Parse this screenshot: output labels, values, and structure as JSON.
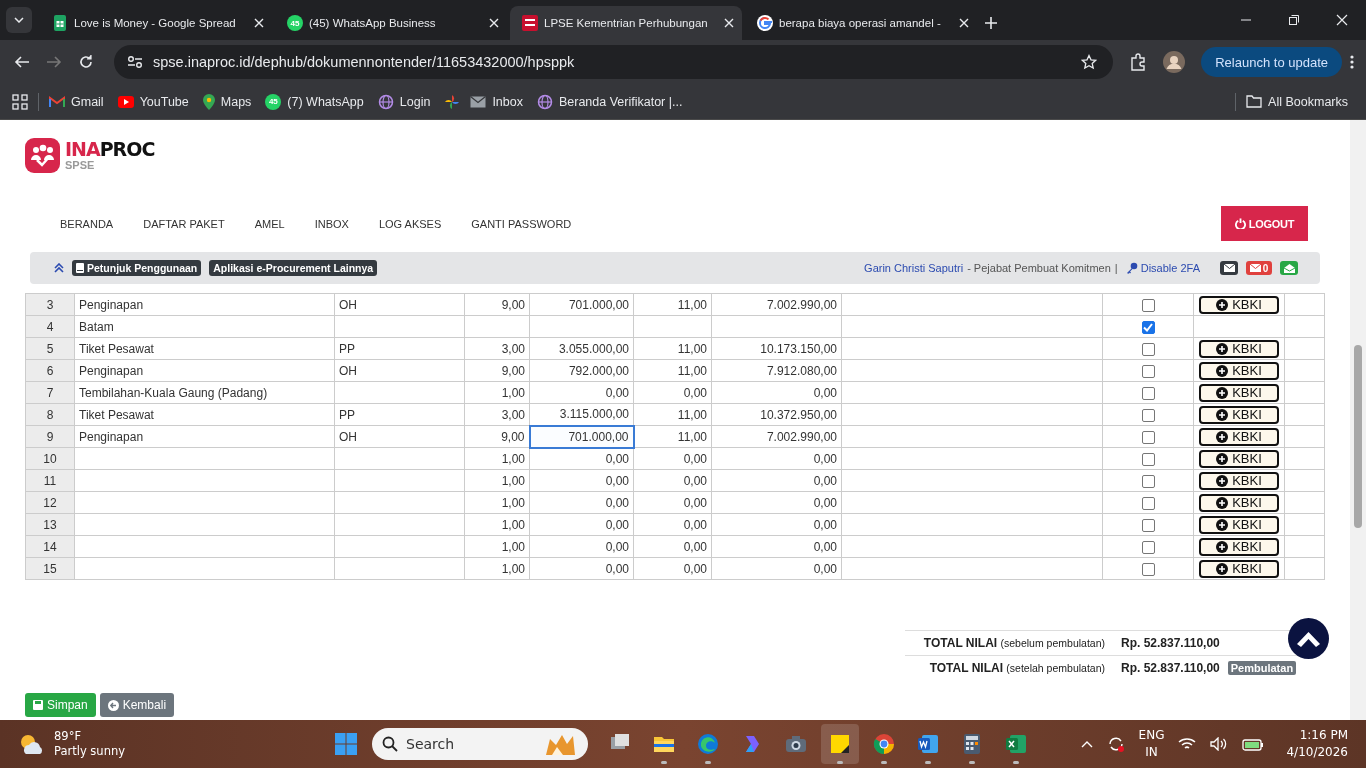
{
  "browser": {
    "tabs": [
      {
        "title": "Love is Money - Google Spread",
        "selected": false
      },
      {
        "title": "(45) WhatsApp Business",
        "selected": false,
        "badge": "45"
      },
      {
        "title": "LPSE Kementrian Perhubungan",
        "selected": true
      },
      {
        "title": "berapa biaya operasi amandel -",
        "selected": false
      }
    ],
    "address": "spse.inaproc.id/dephub/dokumennontender/11653432000/hpsppk",
    "relaunch": "Relaunch to update",
    "bookmarks": [
      {
        "kind": "link",
        "label": "Gmail"
      },
      {
        "kind": "link",
        "label": "YouTube"
      },
      {
        "kind": "link",
        "label": "Maps"
      },
      {
        "kind": "link",
        "label": "(7) WhatsApp",
        "badge": "45"
      },
      {
        "kind": "link",
        "label": "Login"
      },
      {
        "kind": "icon"
      },
      {
        "kind": "link",
        "label": "Inbox"
      },
      {
        "kind": "link",
        "label": "Beranda Verifikator |..."
      }
    ],
    "all_bookmarks": "All Bookmarks"
  },
  "page": {
    "logo": {
      "part_1": "INA",
      "part_2": "PROC",
      "sub": "SPSE"
    },
    "nav": [
      "BERANDA",
      "DAFTAR PAKET",
      "AMEL",
      "INBOX",
      "LOG AKSES",
      "GANTI PASSWORD"
    ],
    "logout": "LOGOUT",
    "info_bar": {
      "links": [
        "Petunjuk Penggunaan",
        "Aplikasi e-Procurement Lainnya"
      ],
      "user": "Garin Christi Saputri",
      "role": "- Pejabat Pembuat Komitmen",
      "separator": "|",
      "disable_2fa": "Disable 2FA",
      "unread": "0"
    },
    "table": {
      "rows": [
        {
          "column_1": "3",
          "column_2": "Penginapan",
          "column_3": "OH",
          "column_4": "9,00",
          "column_5": "701.000,00",
          "column_6": "11,00",
          "column_7": "7.002.990,00",
          "checked": false,
          "focused": false,
          "button": "KBKI"
        },
        {
          "column_1": "4",
          "column_2": "Batam",
          "checked": true,
          "focused": false
        },
        {
          "column_1": "5",
          "column_2": "Tiket Pesawat",
          "column_3": "PP",
          "column_4": "3,00",
          "column_5": "3.055.000,00",
          "column_6": "11,00",
          "column_7": "10.173.150,00",
          "checked": false,
          "focused": false,
          "button": "KBKI"
        },
        {
          "column_1": "6",
          "column_2": "Penginapan",
          "column_3": "OH",
          "column_4": "9,00",
          "column_5": "792.000,00",
          "column_6": "11,00",
          "column_7": "7.912.080,00",
          "checked": false,
          "focused": false,
          "button": "KBKI"
        },
        {
          "column_1": "7",
          "column_2": "Tembilahan-Kuala Gaung (Padang)",
          "column_4": "1,00",
          "column_5": "0,00",
          "column_6": "0,00",
          "column_7": "0,00",
          "checked": false,
          "focused": false,
          "button": "KBKI"
        },
        {
          "column_1": "8",
          "column_2": "Tiket Pesawat",
          "column_3": "PP",
          "column_4": "3,00",
          "column_5": "3.115.000,00",
          "column_6": "11,00",
          "column_7": "10.372.950,00",
          "checked": false,
          "focused": false,
          "button": "KBKI"
        },
        {
          "column_1": "9",
          "column_2": "Penginapan",
          "column_3": "OH",
          "column_4": "9,00",
          "column_5": "701.000,00",
          "column_6": "11,00",
          "column_7": "7.002.990,00",
          "checked": false,
          "focused": true,
          "button": "KBKI"
        },
        {
          "column_1": "10",
          "column_4": "1,00",
          "column_5": "0,00",
          "column_6": "0,00",
          "column_7": "0,00",
          "checked": false,
          "focused": false,
          "button": "KBKI"
        },
        {
          "column_1": "11",
          "column_4": "1,00",
          "column_5": "0,00",
          "column_6": "0,00",
          "column_7": "0,00",
          "checked": false,
          "focused": false,
          "button": "KBKI"
        },
        {
          "column_1": "12",
          "column_4": "1,00",
          "column_5": "0,00",
          "column_6": "0,00",
          "column_7": "0,00",
          "checked": false,
          "focused": false,
          "button": "KBKI"
        },
        {
          "column_1": "13",
          "column_4": "1,00",
          "column_5": "0,00",
          "column_6": "0,00",
          "column_7": "0,00",
          "checked": false,
          "focused": false,
          "button": "KBKI"
        },
        {
          "column_1": "14",
          "column_4": "1,00",
          "column_5": "0,00",
          "column_6": "0,00",
          "column_7": "0,00",
          "checked": false,
          "focused": false,
          "button": "KBKI"
        },
        {
          "column_1": "15",
          "column_4": "1,00",
          "column_5": "0,00",
          "column_6": "0,00",
          "column_7": "0,00",
          "checked": false,
          "focused": false,
          "button": "KBKI"
        }
      ]
    },
    "totals": [
      {
        "label": "TOTAL NILAI",
        "note": "(sebelum pembulatan)",
        "value": "Rp. 52.837.110,00"
      },
      {
        "label": "TOTAL NILAI",
        "note": "(setelah pembulatan)",
        "value": "Rp. 52.837.110,00",
        "badge": "Pembulatan"
      }
    ],
    "buttons": [
      "Simpan",
      "Kembali"
    ]
  },
  "taskbar": {
    "weather": {
      "temp": "89°F",
      "text": "Partly sunny"
    },
    "search": "Search",
    "language": [
      "ENG",
      "IN"
    ],
    "time": "1:16 PM",
    "date": "4/10/2026"
  }
}
